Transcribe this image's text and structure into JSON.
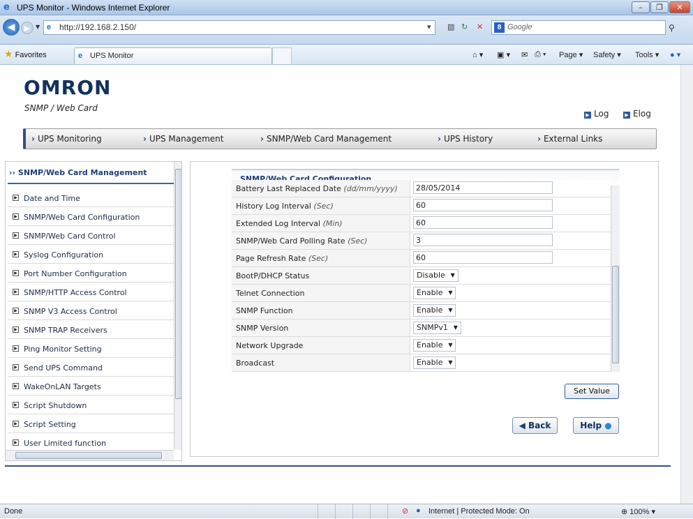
{
  "browser": {
    "window_title": "UPS Monitor - Windows Internet Explorer",
    "url": "http://192.168.2.150/",
    "search_placeholder": "Google",
    "favorites_label": "Favorites",
    "tab_title": "UPS Monitor",
    "commands": [
      "Page ▾",
      "Safety ▾",
      "Tools ▾"
    ],
    "status_left": "Done",
    "status_zone": "Internet | Protected Mode: On",
    "zoom": "100%"
  },
  "header": {
    "logo": "OMRON",
    "subtitle": "SNMP / Web Card",
    "links": [
      "Log",
      "Elog"
    ]
  },
  "nav": [
    "UPS Monitoring",
    "UPS Management",
    "SNMP/Web Card Management",
    "UPS History",
    "External Links"
  ],
  "sidebar": {
    "title": "SNMP/Web Card Management",
    "items": [
      "Date and Time",
      "SNMP/Web Card Configuration",
      "SNMP/Web Card Control",
      "Syslog Configuration",
      "Port Number Configuration",
      "SNMP/HTTP Access Control",
      "SNMP V3 Access Control",
      "SNMP TRAP Receivers",
      "Ping Monitor Setting",
      "Send UPS Command",
      "WakeOnLAN Targets",
      "Script Shutdown",
      "Script Setting",
      "User Limited function"
    ]
  },
  "config": {
    "title": "SNMP/Web Card Configuration",
    "rows": [
      {
        "label": "Battery Last Replaced Date",
        "unit": "(dd/mm/yyyy)",
        "type": "text",
        "value": "28/05/2014"
      },
      {
        "label": "History Log Interval",
        "unit": "(Sec)",
        "type": "text",
        "value": "60"
      },
      {
        "label": "Extended Log Interval",
        "unit": "(Min)",
        "type": "text",
        "value": "60"
      },
      {
        "label": "SNMP/Web Card Polling Rate",
        "unit": "(Sec)",
        "type": "text",
        "value": "3"
      },
      {
        "label": "Page Refresh Rate",
        "unit": "(Sec)",
        "type": "text",
        "value": "60"
      },
      {
        "label": "BootP/DHCP Status",
        "unit": "",
        "type": "select",
        "value": "Disable"
      },
      {
        "label": "Telnet Connection",
        "unit": "",
        "type": "select",
        "value": "Enable"
      },
      {
        "label": "SNMP Function",
        "unit": "",
        "type": "select",
        "value": "Enable"
      },
      {
        "label": "SNMP Version",
        "unit": "",
        "type": "select",
        "value": "SNMPv1"
      },
      {
        "label": "Network Upgrade",
        "unit": "",
        "type": "select",
        "value": "Enable"
      },
      {
        "label": "Broadcast",
        "unit": "",
        "type": "select",
        "value": "Enable"
      }
    ],
    "set_value_label": "Set Value",
    "back_label": "Back",
    "help_label": "Help"
  }
}
